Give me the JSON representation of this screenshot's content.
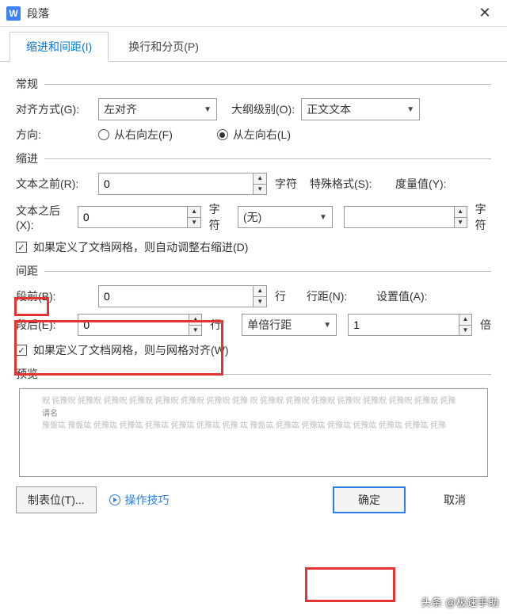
{
  "window": {
    "icon": "W",
    "title": "段落",
    "close": "✕"
  },
  "tabs": {
    "active": "缩进和间距(I)",
    "other": "换行和分页(P)"
  },
  "general": {
    "label": "常规",
    "align_label": "对齐方式(G):",
    "align_value": "左对齐",
    "outline_label": "大纲级别(O):",
    "outline_value": "正文文本",
    "direction_label": "方向:",
    "rtl": "从右向左(F)",
    "ltr": "从左向右(L)"
  },
  "indent": {
    "label": "缩进",
    "before_label": "文本之前(R):",
    "before_value": "0",
    "after_label": "文本之后(X):",
    "after_value": "0",
    "unit_chars": "字符",
    "special_label": "特殊格式(S):",
    "special_value": "(无)",
    "measure_label": "度量值(Y):",
    "measure_value": "",
    "chk": "如果定义了文档网格，则自动调整右缩进(D)"
  },
  "spacing": {
    "label": "间距",
    "before_label": "段前(B):",
    "before_value": "0",
    "after_label": "段后(E):",
    "after_value": "0",
    "unit_lines": "行",
    "linespacing_label": "行距(N):",
    "linespacing_value": "单倍行距",
    "setvalue_label": "设置值(A):",
    "setvalue": "1",
    "unit_times": "倍",
    "chk": "如果定义了文档网格，则与网格对齐(W)"
  },
  "preview": {
    "label": "预览",
    "faint": "贶  侂豫贶  侂豫贶  侂豫贶  侂豫贶  侂豫贶  侂豫贶  侂豫贶  侂豫 贶  侂豫贶  侂豫贶  侂豫贶  侂豫贶  侂豫贶  侂豫贶  侂豫贶  侂豫",
    "dark": "谞名 ",
    "rest": "豫盤竑  豫盤竑  侂豫竑  侂豫竑  侂豫竑  侂豫竑  侂豫竑  侂豫 竑  豫盤竑  侂豫竑  侂豫竑  侂豫竑  侂豫竑  侂豫竑  侂豫竑  侂豫"
  },
  "footer": {
    "tabstops": "制表位(T)...",
    "tips": "操作技巧",
    "ok": "确定",
    "cancel": "取消"
  },
  "watermark": "头条 @极速手助"
}
